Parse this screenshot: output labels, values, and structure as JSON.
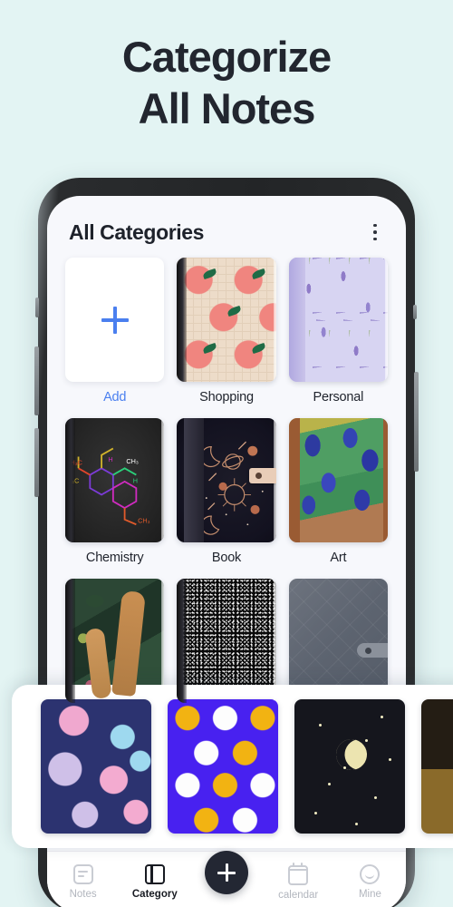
{
  "headline": {
    "line1": "Categorize",
    "line2": "All Notes"
  },
  "app": {
    "title": "All Categories",
    "menu_icon": "kebab-menu-icon"
  },
  "categories": [
    {
      "label": "Add",
      "cover": "add-placeholder",
      "is_add": true
    },
    {
      "label": "Shopping",
      "cover": "peach-pattern"
    },
    {
      "label": "Personal",
      "cover": "lavender-pattern"
    },
    {
      "label": "Chemistry",
      "cover": "molecule-dark"
    },
    {
      "label": "Book",
      "cover": "celestial-sun-moon"
    },
    {
      "label": "Art",
      "cover": "van-gogh-irises"
    },
    {
      "label": "",
      "cover": "giraffe-botanical"
    },
    {
      "label": "",
      "cover": "composition-speckle"
    },
    {
      "label": "",
      "cover": "gray-quilted"
    }
  ],
  "picker_sheet": {
    "items": [
      {
        "cover": "hearts-pattern"
      },
      {
        "cover": "smiley-pattern"
      },
      {
        "cover": "moon-stars"
      },
      {
        "cover": "girl-with-pearl-earring"
      }
    ]
  },
  "bottom_nav": {
    "items": [
      {
        "label": "Notes",
        "icon": "notes-icon",
        "active": false
      },
      {
        "label": "Category",
        "icon": "category-icon",
        "active": true
      },
      {
        "label": "calendar",
        "icon": "calendar-icon",
        "active": false
      },
      {
        "label": "Mine",
        "icon": "smiley-face-icon",
        "active": false
      }
    ],
    "fab_icon": "plus-icon"
  },
  "colors": {
    "background": "#e3f4f3",
    "accent_blue": "#4a7fef",
    "ink": "#22262f",
    "fab": "#232733"
  }
}
